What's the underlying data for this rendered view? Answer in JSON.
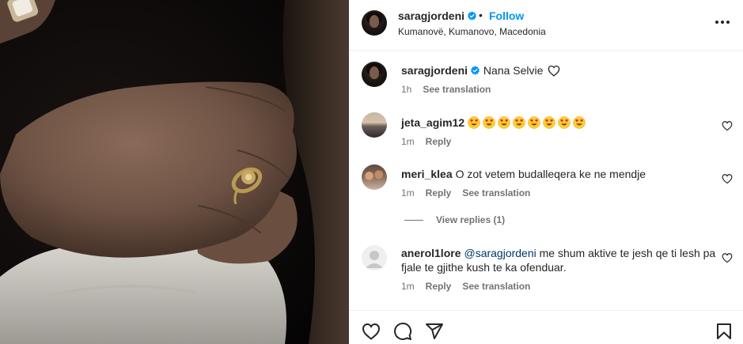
{
  "post": {
    "username": "saragjordeni",
    "separator": "•",
    "follow_label": "Follow",
    "location": "Kumanovë, Kumanovo, Macedonia"
  },
  "caption": {
    "username": "saragjordeni",
    "text": "Nana Selvie",
    "time": "1h",
    "see_translation": "See translation"
  },
  "comments": [
    {
      "username": "jeta_agim12",
      "text": "",
      "emoji_count": 8,
      "time": "1m",
      "reply": "Reply"
    },
    {
      "username": "meri_klea",
      "text": "O zot vetem budalleqera ke ne mendje",
      "time": "1m",
      "reply": "Reply",
      "see_translation": "See translation",
      "view_replies": "View replies (1)"
    },
    {
      "username": "anerol1lore",
      "mention": "@saragjordeni",
      "text_line1": "me shum aktive te jesh qe ti lesh pa",
      "text_line2": "fjale te gjithe kush te ka ofenduar.",
      "time": "1m",
      "reply": "Reply",
      "see_translation": "See translation"
    }
  ],
  "icons": {
    "verified": "verified-badge-icon",
    "more": "more-options-icon",
    "heart": "heart-icon",
    "comment": "comment-icon",
    "share": "share-icon",
    "save": "bookmark-icon"
  },
  "colors": {
    "accent": "#0095f6",
    "muted": "#737373",
    "text": "#262626",
    "mention": "#00376b"
  }
}
